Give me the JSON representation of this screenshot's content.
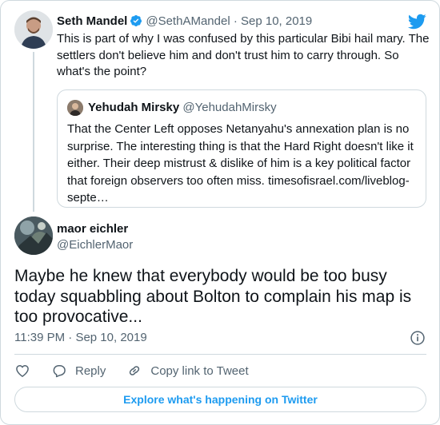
{
  "parent_tweet": {
    "author_name": "Seth Mandel",
    "handle": "@SethAMandel",
    "separator": "·",
    "date": "Sep 10, 2019",
    "text": "This is part of why I was confused by this particular Bibi hail mary. The settlers don't believe him and don't trust him to carry through. So what's the point?"
  },
  "quoted_tweet": {
    "author_name": "Yehudah Mirsky",
    "handle": "@YehudahMirsky",
    "text": "That the Center Left opposes Netanyahu's annexation plan is no surprise.  The interesting thing is that the Hard Right doesn't like it either. Their deep mistrust & dislike of him is a key political factor that foreign observers too often miss. timesofisrael.com/liveblog-septe…"
  },
  "main_tweet": {
    "author_name": "maor eichler",
    "handle": "@EichlerMaor",
    "text": "Maybe he knew that everybody would be too busy today squabbling about Bolton to complain his map is too provocative...",
    "time": "11:39 PM",
    "separator": "·",
    "date": "Sep 10, 2019"
  },
  "actions": {
    "reply_label": "Reply",
    "copy_link_label": "Copy link to Tweet"
  },
  "explore_label": "Explore what's happening on Twitter",
  "colors": {
    "accent": "#1d9bf0",
    "text": "#0f1419",
    "muted": "#536471",
    "border": "#cfd9de"
  },
  "icons": [
    "verified-badge-icon",
    "twitter-bird-icon",
    "info-icon",
    "heart-icon",
    "reply-icon",
    "link-icon"
  ]
}
